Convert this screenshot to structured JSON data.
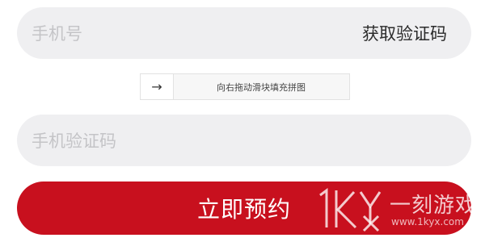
{
  "phone": {
    "placeholder": "手机号",
    "get_code_label": "获取验证码"
  },
  "slider": {
    "handle_icon": "arrow-right-icon",
    "handle_glyph": "→",
    "hint": "向右拖动滑块填充拼图"
  },
  "code": {
    "placeholder": "手机验证码"
  },
  "submit": {
    "label": "立即预约"
  },
  "watermark": {
    "text": "一刻游戏网",
    "url": "www.1kyx.com"
  },
  "colors": {
    "accent": "#c8101e",
    "field_bg": "#efeff1",
    "placeholder": "#c4c4c7"
  }
}
